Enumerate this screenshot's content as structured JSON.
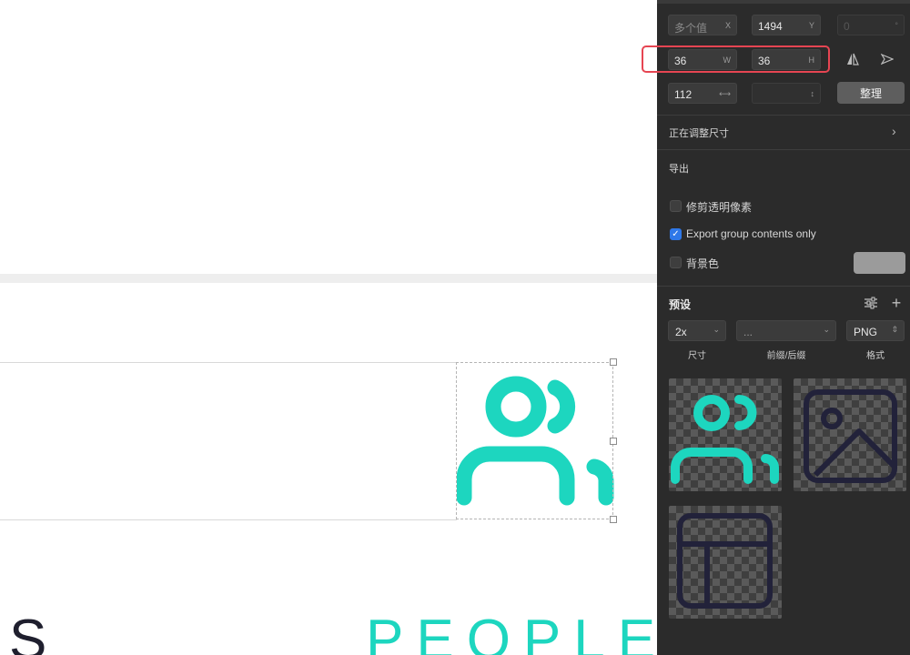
{
  "canvas": {
    "text_left": "S",
    "text_right": "PEOPLE",
    "accent": "#1dd6bf",
    "dark": "#1f1f2e"
  },
  "inspector": {
    "position": {
      "x_value": "多个值",
      "x_label": "X",
      "y_value": "1494",
      "y_label": "Y",
      "rotation_value": "0",
      "rotation_unit": "°"
    },
    "size": {
      "w_value": "36",
      "w_label": "W",
      "h_value": "36",
      "h_label": "H"
    },
    "spacing": {
      "value": "112",
      "value_icon": "horizontal-spacing-icon",
      "vertical_icon": "vertical-spacing-icon",
      "tidy_button": "整理"
    },
    "resizing_label": "正在调整尺寸",
    "export": {
      "section_label": "导出",
      "trim_label": "修剪透明像素",
      "trim_checked": false,
      "group_only_label": "Export group contents only",
      "group_only_checked": true,
      "background_label": "背景色",
      "background_checked": false,
      "background_color": "#9b9b9b"
    },
    "presets": {
      "title": "预设",
      "scale": "2x",
      "prefix_suffix": "...",
      "format": "PNG",
      "scale_label": "尺寸",
      "prefix_label": "前缀/后缀",
      "format_label": "格式"
    },
    "thumbnails": [
      {
        "name": "people-icon",
        "color": "#1dd6bf"
      },
      {
        "name": "image-icon",
        "color": "#22223a"
      },
      {
        "name": "layout-icon",
        "color": "#22223a"
      }
    ],
    "highlight_color": "#e64552"
  }
}
